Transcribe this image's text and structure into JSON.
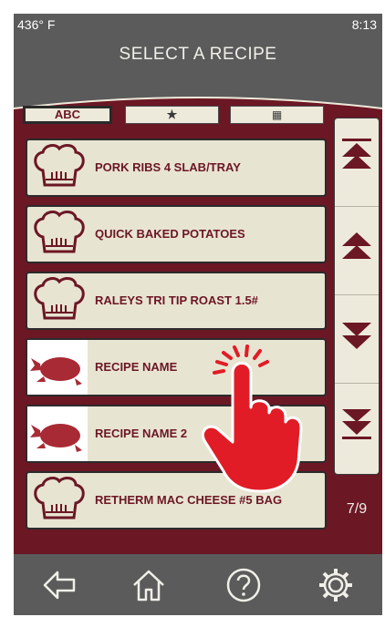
{
  "status": {
    "temperature": "436° F",
    "time": "8:13"
  },
  "header": {
    "title": "SELECT A RECIPE"
  },
  "filters": {
    "abc": "ABC",
    "favorites": "★",
    "calendar": "▦",
    "active": "abc"
  },
  "recipes": [
    {
      "name": "PORK RIBS 4 SLAB/TRAY",
      "icon": "chef-hat-icon"
    },
    {
      "name": "QUICK BAKED POTATOES",
      "icon": "chef-hat-icon"
    },
    {
      "name": "RALEYS TRI TIP ROAST 1.5#",
      "icon": "chef-hat-icon"
    },
    {
      "name": "RECIPE NAME",
      "icon": "roast-chicken-icon"
    },
    {
      "name": "RECIPE NAME 2",
      "icon": "roast-chicken-icon"
    },
    {
      "name": "RETHERM MAC CHEESE #5 BAG",
      "icon": "chef-hat-icon"
    }
  ],
  "pagination": {
    "text": "7/9"
  },
  "scroll_controls": [
    "scroll-to-top-icon",
    "page-up-icon",
    "page-down-icon",
    "scroll-to-bottom-icon"
  ],
  "bottom_nav": [
    "back-arrow-icon",
    "home-icon",
    "help-icon",
    "settings-gear-icon"
  ],
  "colors": {
    "panel": "#6b1724",
    "card": "#e8e4d2",
    "chrome": "#5b5b5b",
    "hand": "#e21c26"
  }
}
